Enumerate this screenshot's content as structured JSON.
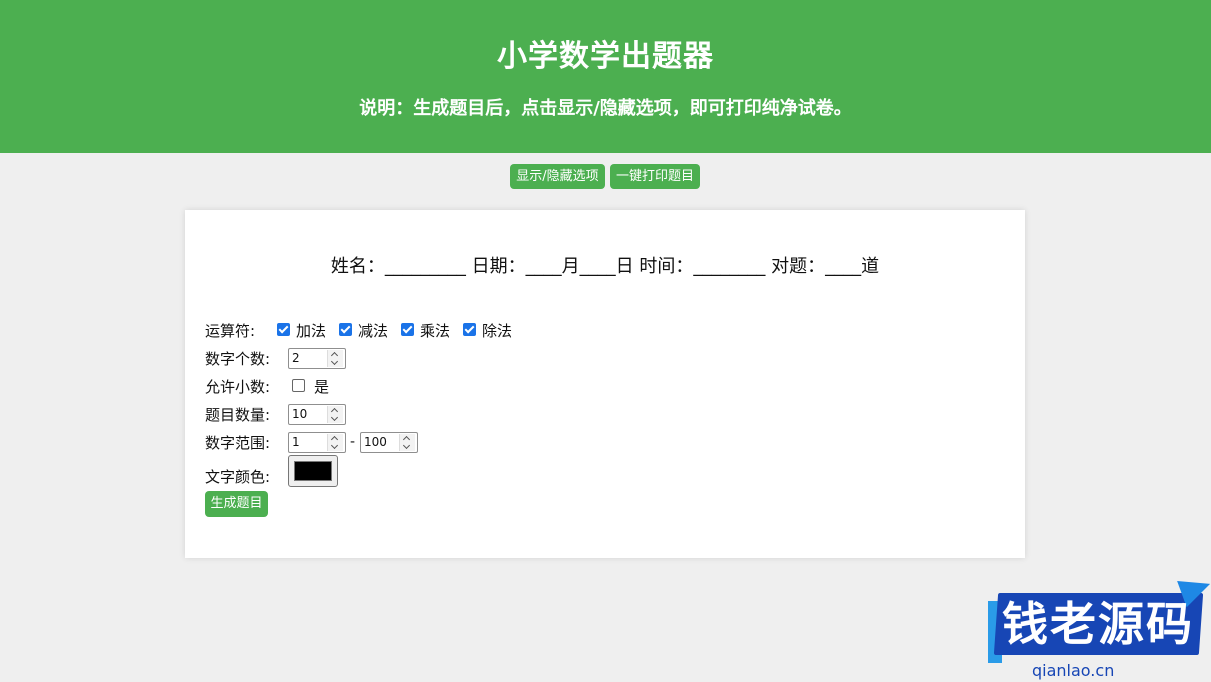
{
  "header": {
    "title": "小学数学出题器",
    "subtitle": "说明：生成题目后，点击显示/隐藏选项，即可打印纯净试卷。"
  },
  "colors": {
    "accent": "#4caf50",
    "background": "#efefef",
    "checkbox": "#1a73e8",
    "text_color_value": "#000000"
  },
  "toolbar": {
    "toggle_label": "显示/隐藏选项",
    "print_label": "一键打印题目"
  },
  "info_line": "姓名：_________ 日期：____月____日 时间：________ 对题：____道",
  "options": {
    "operators": {
      "label": "运算符:",
      "items": [
        {
          "label": "加法",
          "checked": true
        },
        {
          "label": "减法",
          "checked": true
        },
        {
          "label": "乘法",
          "checked": true
        },
        {
          "label": "除法",
          "checked": true
        }
      ]
    },
    "number_count": {
      "label": "数字个数:",
      "value": "2"
    },
    "allow_decimal": {
      "label": "允许小数:",
      "option_label": "是",
      "checked": false
    },
    "question_count": {
      "label": "题目数量:",
      "value": "10"
    },
    "number_range": {
      "label": "数字范围:",
      "min": "1",
      "separator": "-",
      "max": "100"
    },
    "text_color": {
      "label": "文字颜色:"
    },
    "generate_label": "生成题目"
  },
  "watermark": {
    "text": "钱老源码",
    "url": "qianlao.cn"
  }
}
